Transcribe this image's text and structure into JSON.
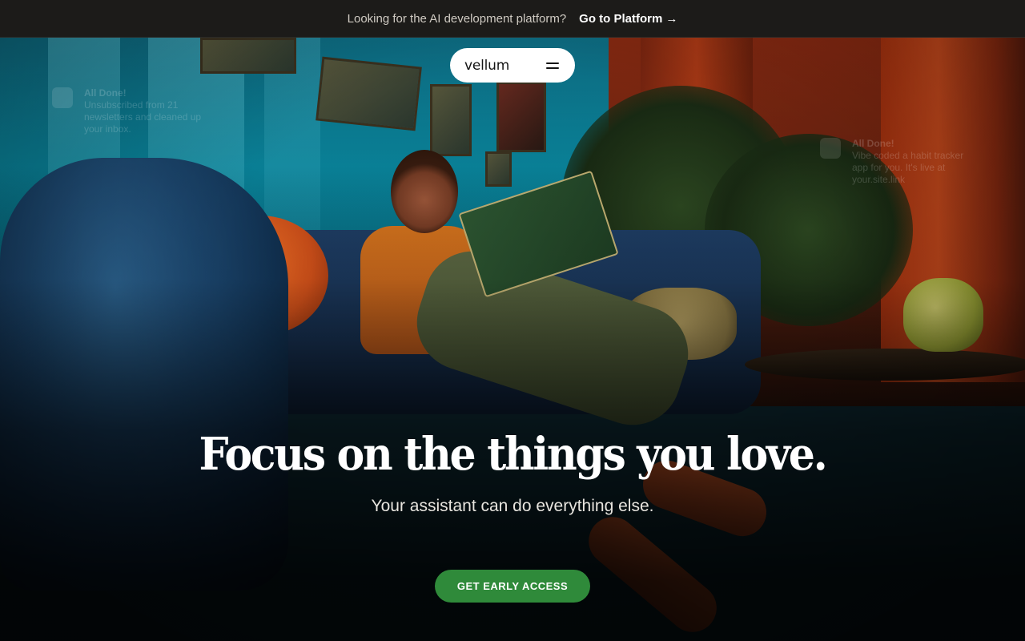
{
  "banner": {
    "text": "Looking for the AI development platform?",
    "link_label": "Go to Platform",
    "arrow": "→"
  },
  "nav": {
    "logo": "vellum",
    "menu_icon": "hamburger-menu-icon"
  },
  "notifications": [
    {
      "title": "All Done!",
      "body": "Unsubscribed from 21 newsletters and cleaned up your inbox."
    },
    {
      "title": "All Done!",
      "body": "Vibe coded a habit tracker app for you. It's live at your.site.link"
    }
  ],
  "hero": {
    "headline": "Focus on the things you love.",
    "subheadline": "Your assistant can do everything else.",
    "cta_label": "GET EARLY ACCESS"
  },
  "colors": {
    "banner_bg": "#1c1b19",
    "cta_green": "#2f8a3a",
    "nav_pill_bg": "#ffffff",
    "text_light": "#ffffff"
  }
}
